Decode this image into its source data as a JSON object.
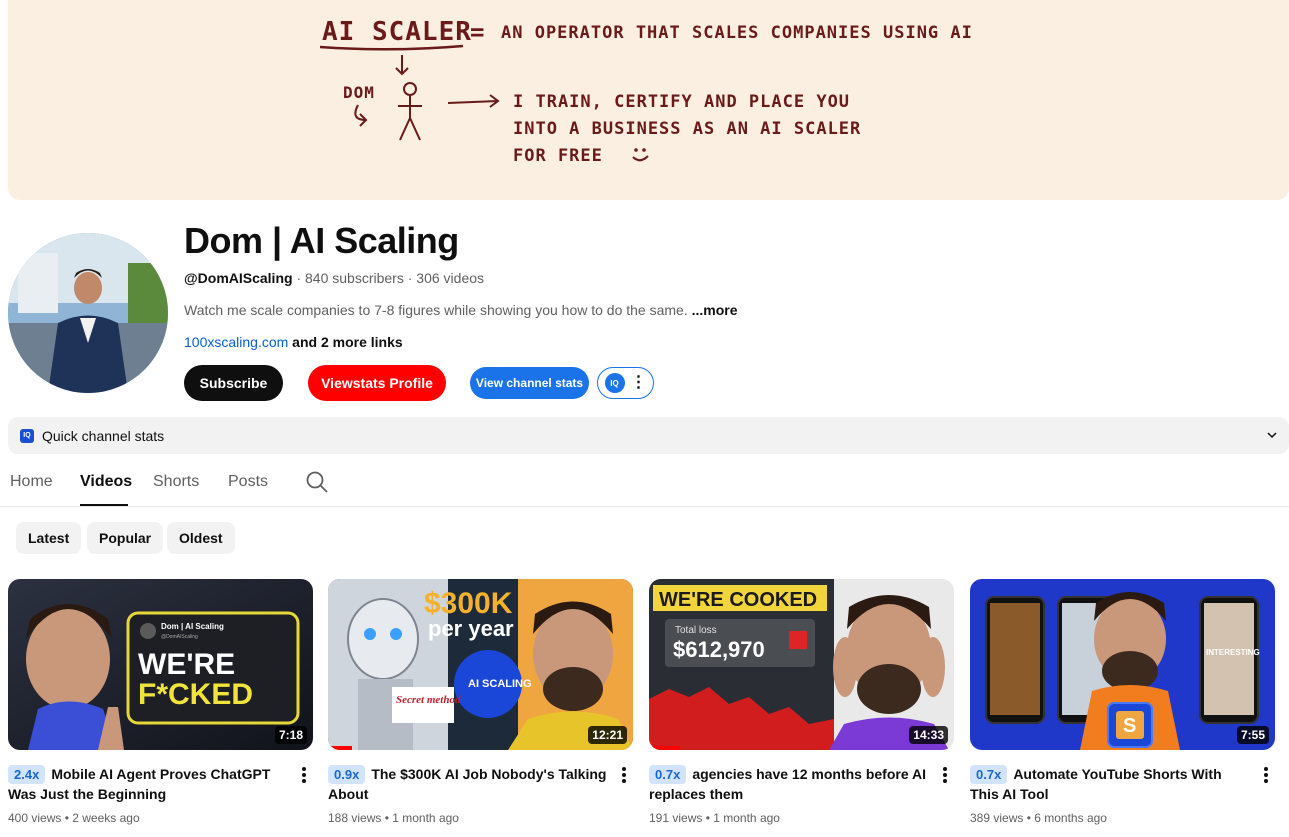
{
  "banner": {
    "title": "AI SCALER",
    "equals": "=",
    "definition": "AN OPERATOR THAT SCALES COMPANIES USING AI",
    "name": "DOM",
    "line1": "I TRAIN, CERTIFY AND PLACE YOU",
    "line2": "INTO A BUSINESS AS AN AI SCALER",
    "line3": "FOR FREE"
  },
  "channel": {
    "name": "Dom | AI Scaling",
    "handle": "@DomAIScaling",
    "subscribers": "840 subscribers",
    "videos": "306 videos",
    "sep": "·",
    "description": "Watch me scale companies to 7-8 figures while showing you how to do the same.",
    "more": "...more",
    "link": "100xscaling.com",
    "more_links": "and 2 more links"
  },
  "buttons": {
    "subscribe": "Subscribe",
    "viewstats": "Viewstats Profile",
    "view_stats": "View channel stats",
    "iq": "IQ"
  },
  "quick_stats": {
    "icon": "IQ",
    "label": "Quick channel stats"
  },
  "tabs": [
    {
      "label": "Home"
    },
    {
      "label": "Videos"
    },
    {
      "label": "Shorts"
    },
    {
      "label": "Posts"
    }
  ],
  "chips": [
    "Latest",
    "Popular",
    "Oldest"
  ],
  "videos": [
    {
      "multiplier": "2.4x",
      "title": "Mobile AI Agent Proves ChatGPT Was Just the Beginning",
      "views": "400 views",
      "age": "2 weeks ago",
      "duration": "7:18",
      "thumb_text1": "WE'RE",
      "thumb_text2": "F*CKED",
      "thumb_badge": "Dom | AI Scaling",
      "thumb_badge_handle": "@DomAIScaling"
    },
    {
      "multiplier": "0.9x",
      "title": "The $300K AI Job Nobody's Talking About",
      "views": "188 views",
      "age": "1 month ago",
      "duration": "12:21",
      "thumb_text1": "$300K",
      "thumb_text2": "per year",
      "thumb_text3": "AI SCALING",
      "thumb_text4": "Secret method",
      "progress": 0.08
    },
    {
      "multiplier": "0.7x",
      "title": "agencies have 12 months before AI replaces them",
      "views": "191 views",
      "age": "1 month ago",
      "duration": "14:33",
      "thumb_text1": "WE'RE COOKED",
      "thumb_text2": "Total loss",
      "thumb_text3": "$612,970",
      "progress": 0.1
    },
    {
      "multiplier": "0.7x",
      "title": "Automate YouTube Shorts With This AI Tool",
      "views": "389 views",
      "age": "6 months ago",
      "duration": "7:55",
      "thumb_text1": "INTERESTING",
      "thumb_text2": "S"
    }
  ],
  "colors": {
    "banner_bg": "#fbefe2",
    "banner_ink": "#6b1a1a",
    "viewstats_red": "#ff0000",
    "stats_blue": "#1a73e8",
    "multiplier_bg": "#d2e3fc"
  }
}
